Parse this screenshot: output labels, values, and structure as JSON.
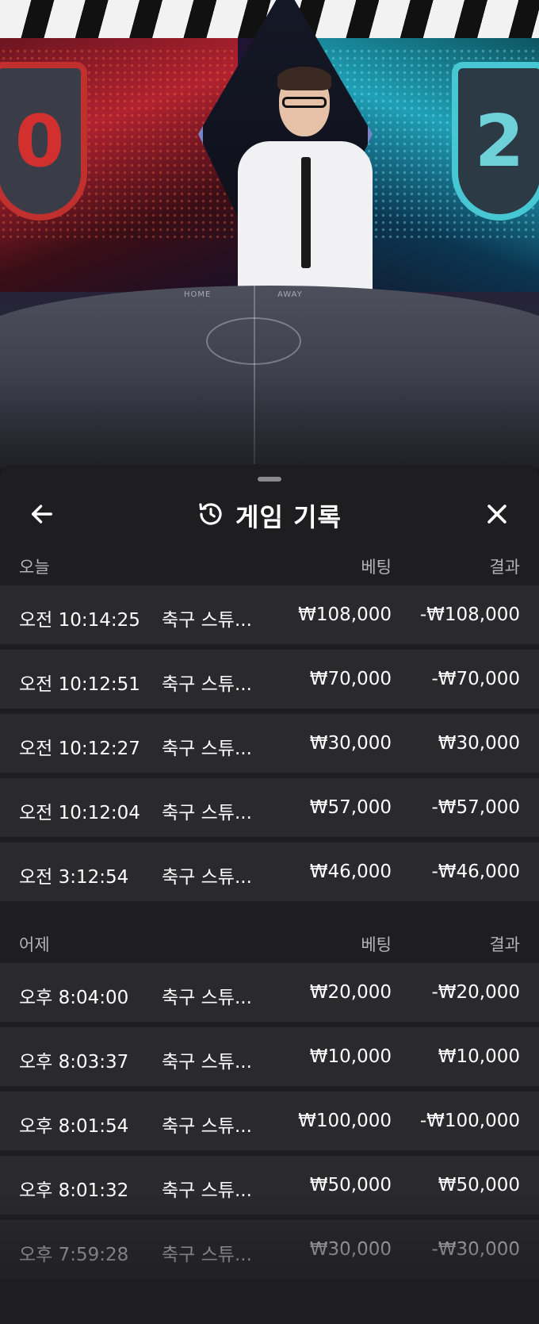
{
  "video": {
    "left_score": "0",
    "right_score": "2",
    "table_home": "HOME",
    "table_away": "AWAY"
  },
  "header": {
    "title": "게임 기록",
    "back_icon": "arrow-left-icon",
    "history_icon": "history-icon",
    "close_icon": "close-icon"
  },
  "labels": {
    "bet": "베팅",
    "result": "결과"
  },
  "today": {
    "label": "오늘",
    "rows": [
      {
        "time": "오전 10:14:25",
        "game": "축구 스튜...",
        "bet": "₩108,000",
        "result": "-₩108,000"
      },
      {
        "time": "오전 10:12:51",
        "game": "축구 스튜...",
        "bet": "₩70,000",
        "result": "-₩70,000"
      },
      {
        "time": "오전 10:12:27",
        "game": "축구 스튜...",
        "bet": "₩30,000",
        "result": "₩30,000"
      },
      {
        "time": "오전 10:12:04",
        "game": "축구 스튜...",
        "bet": "₩57,000",
        "result": "-₩57,000"
      },
      {
        "time": "오전 3:12:54",
        "game": "축구 스튜...",
        "bet": "₩46,000",
        "result": "-₩46,000"
      }
    ]
  },
  "yesterday": {
    "label": "어제",
    "rows": [
      {
        "time": "오후 8:04:00",
        "game": "축구 스튜...",
        "bet": "₩20,000",
        "result": "-₩20,000"
      },
      {
        "time": "오후 8:03:37",
        "game": "축구 스튜...",
        "bet": "₩10,000",
        "result": "₩10,000"
      },
      {
        "time": "오후 8:01:54",
        "game": "축구 스튜...",
        "bet": "₩100,000",
        "result": "-₩100,000"
      },
      {
        "time": "오후 8:01:32",
        "game": "축구 스튜...",
        "bet": "₩50,000",
        "result": "₩50,000"
      },
      {
        "time": "오후 7:59:28",
        "game": "축구 스튜...",
        "bet": "₩30,000",
        "result": "-₩30,000"
      }
    ]
  }
}
